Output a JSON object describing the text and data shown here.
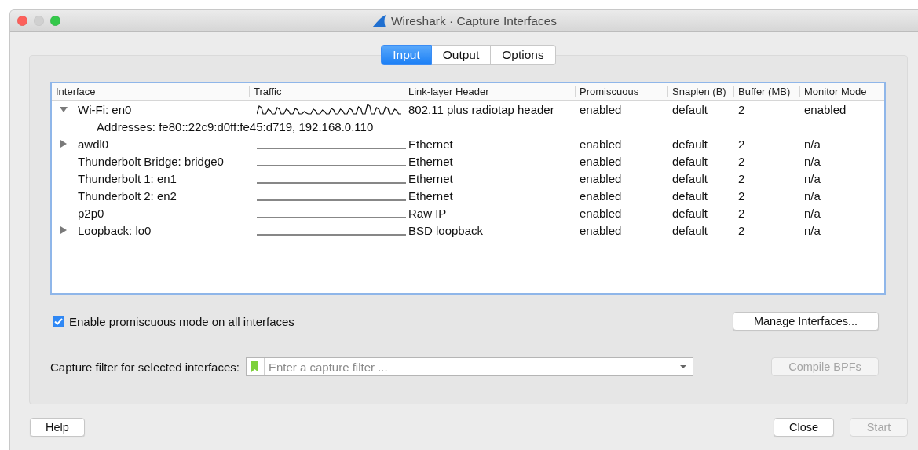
{
  "window": {
    "title": "Wireshark · Capture Interfaces"
  },
  "tabs": [
    {
      "label": "Input",
      "selected": true
    },
    {
      "label": "Output",
      "selected": false
    },
    {
      "label": "Options",
      "selected": false
    }
  ],
  "table": {
    "columns": [
      "Interface",
      "Traffic",
      "Link-layer Header",
      "Promiscuous",
      "Snaplen (B)",
      "Buffer (MB)",
      "Monitor Mode"
    ],
    "rows": [
      {
        "interface": "Wi-Fi: en0",
        "expanded": true,
        "traffic_active": true,
        "link": "802.11 plus radiotap header",
        "promiscuous": "enabled",
        "snaplen": "default",
        "buffer": "2",
        "monitor": "enabled",
        "detail": "Addresses: fe80::22c9:d0ff:fe45:d719, 192.168.0.110"
      },
      {
        "interface": "awdl0",
        "expanded": false,
        "traffic_active": false,
        "link": "Ethernet",
        "promiscuous": "enabled",
        "snaplen": "default",
        "buffer": "2",
        "monitor": "n/a"
      },
      {
        "interface": "Thunderbolt Bridge: bridge0",
        "traffic_active": false,
        "link": "Ethernet",
        "promiscuous": "enabled",
        "snaplen": "default",
        "buffer": "2",
        "monitor": "n/a"
      },
      {
        "interface": "Thunderbolt 1: en1",
        "traffic_active": false,
        "link": "Ethernet",
        "promiscuous": "enabled",
        "snaplen": "default",
        "buffer": "2",
        "monitor": "n/a"
      },
      {
        "interface": "Thunderbolt 2: en2",
        "traffic_active": false,
        "link": "Ethernet",
        "promiscuous": "enabled",
        "snaplen": "default",
        "buffer": "2",
        "monitor": "n/a"
      },
      {
        "interface": "p2p0",
        "traffic_active": false,
        "link": "Raw IP",
        "promiscuous": "enabled",
        "snaplen": "default",
        "buffer": "2",
        "monitor": "n/a"
      },
      {
        "interface": "Loopback: lo0",
        "expanded": false,
        "traffic_active": false,
        "link": "BSD loopback",
        "promiscuous": "enabled",
        "snaplen": "default",
        "buffer": "2",
        "monitor": "n/a"
      }
    ]
  },
  "promiscuous_checkbox": {
    "label": "Enable promiscuous mode on all interfaces",
    "checked": true
  },
  "manage_button": {
    "label": "Manage Interfaces...",
    "disabled": false
  },
  "capture_filter": {
    "label": "Capture filter for selected interfaces:",
    "placeholder": "Enter a capture filter ..."
  },
  "compile_button": {
    "label": "Compile BPFs",
    "disabled": true
  },
  "footer_buttons": [
    {
      "label": "Help",
      "disabled": false
    },
    {
      "label": "Close",
      "disabled": false
    },
    {
      "label": "Start",
      "disabled": true
    }
  ]
}
